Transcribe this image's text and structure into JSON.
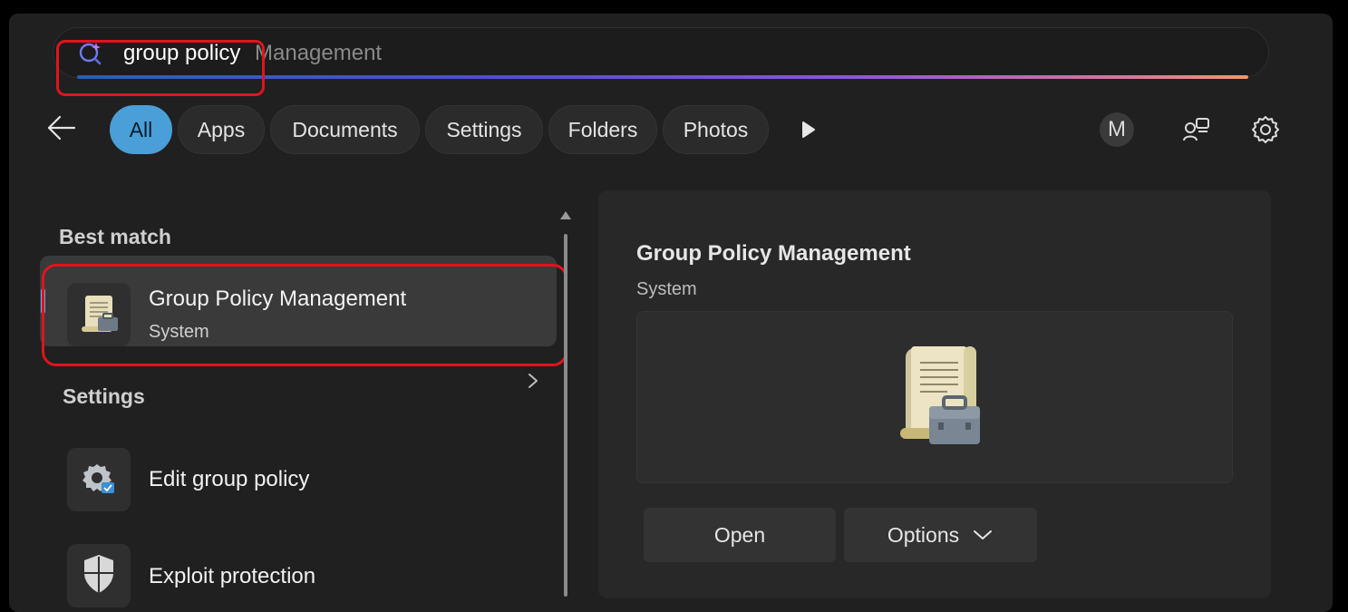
{
  "search": {
    "query": "group policy",
    "suggestion": "Management"
  },
  "filters": {
    "tabs": [
      "All",
      "Apps",
      "Documents",
      "Settings",
      "Folders",
      "Photos"
    ],
    "active": "All"
  },
  "account": {
    "initial": "M"
  },
  "results": {
    "best_match_label": "Best match",
    "best_match": {
      "title": "Group Policy Management",
      "subtitle": "System"
    },
    "settings_label": "Settings",
    "settings_items": [
      {
        "label": "Edit group policy",
        "icon": "gear-check-icon"
      },
      {
        "label": "Exploit protection",
        "icon": "shield-icon"
      }
    ]
  },
  "preview": {
    "title": "Group Policy Management",
    "subtitle": "System",
    "open_label": "Open",
    "options_label": "Options"
  },
  "colors": {
    "accent": "#4a9fd8",
    "highlight": "#e0141e",
    "panel": "#202020"
  }
}
